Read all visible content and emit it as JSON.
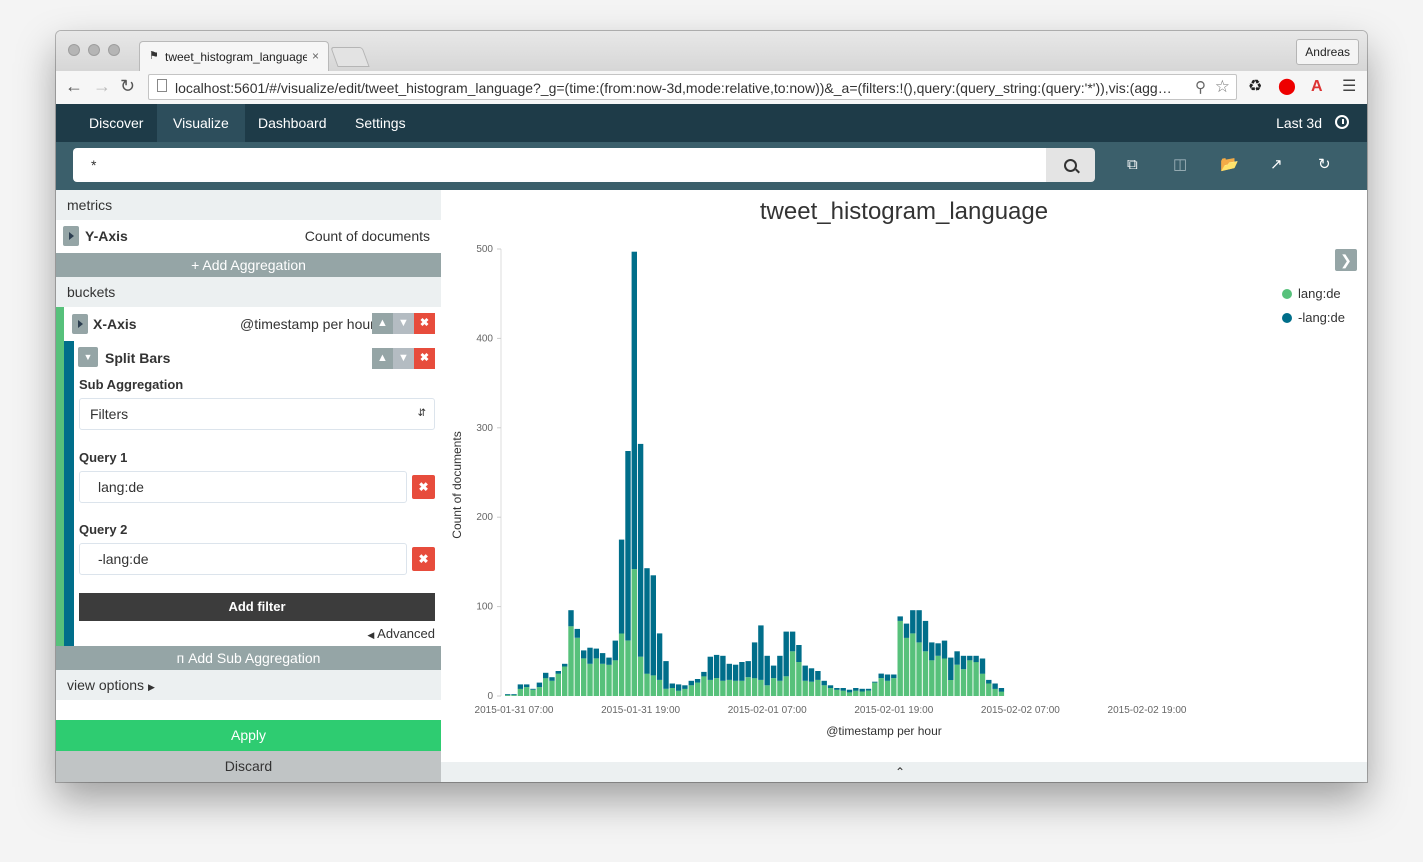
{
  "browser": {
    "tab_title": "tweet_histogram_language",
    "tab_close": "×",
    "profile": "Andreas",
    "url": "localhost:5601/#/visualize/edit/tweet_histogram_language?_g=(time:(from:now-3d,mode:relative,to:now))&_a=(filters:!(),query:(query_string:(query:'*')),vis:(agg…"
  },
  "nav": {
    "items": [
      "Discover",
      "Visualize",
      "Dashboard",
      "Settings"
    ],
    "active": "Visualize",
    "time": "Last 3d"
  },
  "search": {
    "query": "*"
  },
  "sidebar": {
    "metrics_header": "metrics",
    "y_axis_label": "Y-Axis",
    "y_axis_value": "Count of documents",
    "add_aggregation": "Add Aggregation",
    "buckets_header": "buckets",
    "x_axis_label": "X-Axis",
    "x_axis_value": "@timestamp per hour",
    "split_bars": "Split Bars",
    "sub_agg_label": "Sub Aggregation",
    "sub_agg_value": "Filters",
    "query1_label": "Query 1",
    "query1_value": "lang:de",
    "query2_label": "Query 2",
    "query2_value": "-lang:de",
    "add_filter": "Add filter",
    "advanced": "Advanced",
    "add_sub_agg": "Add Sub Aggregation",
    "view_options": "view options",
    "apply": "Apply",
    "discard": "Discard"
  },
  "colors": {
    "lang_de": "#57c17b",
    "not_lang_de": "#006e8a",
    "apply": "#2ecc71"
  },
  "chart_data": {
    "type": "bar",
    "title": "tweet_histogram_language",
    "xlabel": "@timestamp per hour",
    "ylabel": "Count of documents",
    "ylim": [
      0,
      500
    ],
    "yticks": [
      0,
      100,
      200,
      300,
      400,
      500
    ],
    "xtick_labels": [
      "2015-01-31 07:00",
      "2015-01-31 19:00",
      "2015-02-01 07:00",
      "2015-02-01 19:00",
      "2015-02-02 07:00",
      "2015-02-02 19:00"
    ],
    "legend_position": "top-right",
    "stacked": true,
    "series": [
      {
        "name": "lang:de",
        "color": "#57c17b",
        "values": [
          1,
          1,
          8,
          10,
          7,
          10,
          20,
          17,
          25,
          33,
          78,
          65,
          42,
          36,
          42,
          36,
          35,
          40,
          70,
          62,
          142,
          44,
          25,
          23,
          18,
          8,
          9,
          6,
          8,
          12,
          15,
          22,
          18,
          20,
          17,
          18,
          17,
          17,
          21,
          20,
          18,
          12,
          20,
          17,
          22,
          50,
          38,
          17,
          16,
          18,
          12,
          9,
          7,
          6,
          4,
          6,
          5,
          6,
          15,
          20,
          17,
          20,
          84,
          65,
          70,
          60,
          50,
          40,
          45,
          42,
          18,
          35,
          30,
          40,
          38,
          25,
          14,
          8,
          5
        ]
      },
      {
        "name": "-lang:de",
        "color": "#006e8a",
        "values": [
          1,
          1,
          5,
          3,
          1,
          5,
          6,
          4,
          3,
          3,
          18,
          10,
          9,
          18,
          11,
          12,
          8,
          22,
          105,
          212,
          355,
          238,
          118,
          112,
          52,
          31,
          5,
          7,
          4,
          5,
          4,
          5,
          26,
          26,
          28,
          18,
          18,
          21,
          18,
          40,
          61,
          33,
          14,
          28,
          50,
          22,
          19,
          17,
          15,
          10,
          5,
          3,
          2,
          3,
          3,
          3,
          3,
          2,
          1,
          5,
          7,
          4,
          5,
          16,
          26,
          36,
          34,
          20,
          14,
          20,
          25,
          15,
          15,
          5,
          7,
          17,
          4,
          6,
          4
        ]
      }
    ]
  }
}
